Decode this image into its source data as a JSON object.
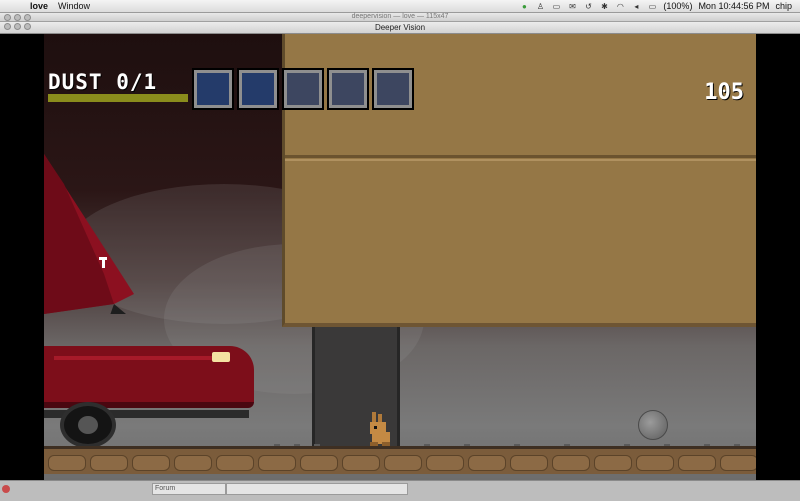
{
  "menubar": {
    "app_name": "love",
    "menus": [
      "Window"
    ],
    "battery": "(100%)",
    "clock": "Mon 10:44:56 PM",
    "user": "chip"
  },
  "windows": {
    "terminal_title": "deepervision — love — 115x47",
    "game_title": "Deeper Vision",
    "bottom_field": "Forum"
  },
  "hud": {
    "dust_label": "DUST 0/1",
    "dust_progress": 0.0,
    "timer": "105",
    "slots": [
      "filled",
      "filled",
      "empty",
      "empty",
      "empty"
    ]
  },
  "colors": {
    "building": "#957746",
    "car": "#7d0e1a",
    "ground": "#7b5c3b",
    "dust_bar": "#8a8c1c",
    "slot_filled": "#243b6a"
  }
}
